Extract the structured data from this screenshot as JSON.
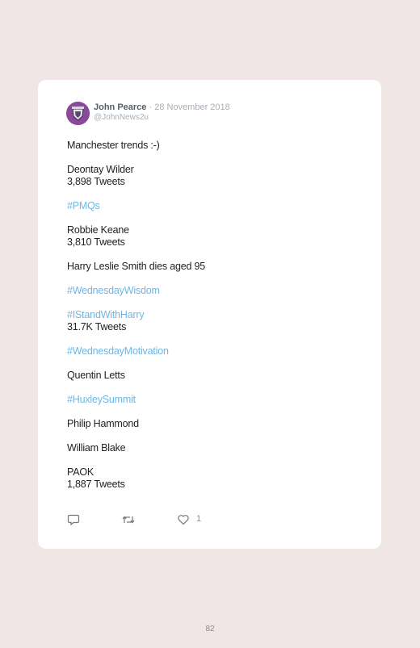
{
  "tweet": {
    "author_name": "John Pearce",
    "date": "· 28 November 2018",
    "handle": "@JohnNews2u",
    "lines": [
      {
        "text": "Manchester trends :-)",
        "kind": "text"
      },
      {
        "text": "",
        "kind": "gap"
      },
      {
        "text": "Deontay Wilder",
        "kind": "text"
      },
      {
        "text": "3,898 Tweets",
        "kind": "text"
      },
      {
        "text": "",
        "kind": "gap"
      },
      {
        "text": "#PMQs",
        "kind": "hashtag"
      },
      {
        "text": "",
        "kind": "gap"
      },
      {
        "text": "Robbie Keane",
        "kind": "text"
      },
      {
        "text": "3,810 Tweets",
        "kind": "text"
      },
      {
        "text": "",
        "kind": "gap"
      },
      {
        "text": "Harry Leslie Smith dies aged 95",
        "kind": "text"
      },
      {
        "text": "",
        "kind": "gap"
      },
      {
        "text": "#WednesdayWisdom",
        "kind": "hashtag"
      },
      {
        "text": "",
        "kind": "gap"
      },
      {
        "text": "#IStandWithHarry",
        "kind": "hashtag"
      },
      {
        "text": "31.7K Tweets",
        "kind": "text"
      },
      {
        "text": "",
        "kind": "gap"
      },
      {
        "text": "#WednesdayMotivation",
        "kind": "hashtag"
      },
      {
        "text": "",
        "kind": "gap"
      },
      {
        "text": "Quentin Letts",
        "kind": "text"
      },
      {
        "text": "",
        "kind": "gap"
      },
      {
        "text": "#HuxleySummit",
        "kind": "hashtag"
      },
      {
        "text": "",
        "kind": "gap"
      },
      {
        "text": "Philip Hammond",
        "kind": "text"
      },
      {
        "text": "",
        "kind": "gap"
      },
      {
        "text": "William Blake",
        "kind": "text"
      },
      {
        "text": "",
        "kind": "gap"
      },
      {
        "text": "PAOK",
        "kind": "text"
      },
      {
        "text": "1,887 Tweets",
        "kind": "text"
      }
    ],
    "like_count": "1",
    "icons": [
      "reply-icon",
      "retweet-icon",
      "heart-icon"
    ],
    "colors": {
      "hashtag": "#6cb6e5",
      "background": "#f0e6e6",
      "card": "#ffffff"
    }
  },
  "page_number": "82"
}
